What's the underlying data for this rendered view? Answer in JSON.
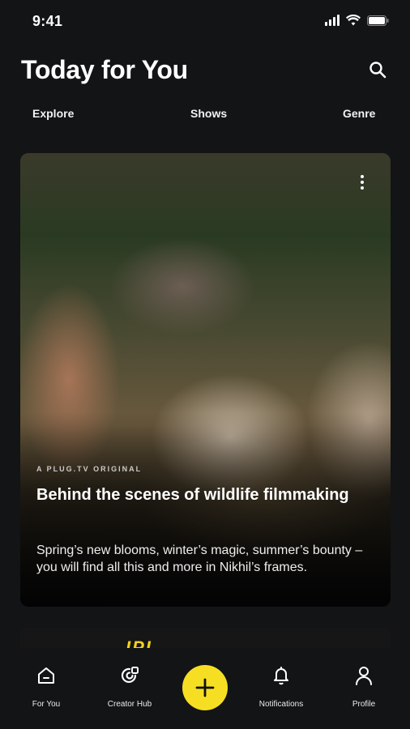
{
  "status_bar": {
    "time": "9:41",
    "signal_icon": "cellular-signal-icon",
    "wifi_icon": "wifi-icon",
    "battery_icon": "battery-icon"
  },
  "header": {
    "title": "Today for You",
    "search_icon": "search-icon"
  },
  "tabs": [
    {
      "label": "Explore"
    },
    {
      "label": "Shows"
    },
    {
      "label": "Genre"
    }
  ],
  "feature_card": {
    "eyebrow": "A PLUG.TV ORIGINAL",
    "title": "Behind the scenes of wildlife filmmaking",
    "description": "Spring’s new blooms, winter’s magic, summer’s bounty – you will find all this and more in Nikhil’s frames.",
    "menu_icon": "more-vertical-icon"
  },
  "next_card": {
    "logo_text": "IPL"
  },
  "bottom_nav": {
    "items": [
      {
        "label": "For You",
        "icon": "home-icon"
      },
      {
        "label": "Creator Hub",
        "icon": "creator-hub-icon"
      },
      {
        "label": "Notifications",
        "icon": "bell-icon"
      },
      {
        "label": "Profile",
        "icon": "person-icon"
      }
    ],
    "fab_icon": "plus-icon"
  },
  "colors": {
    "background": "#121416",
    "accent": "#f6df22",
    "text": "#ffffff"
  }
}
